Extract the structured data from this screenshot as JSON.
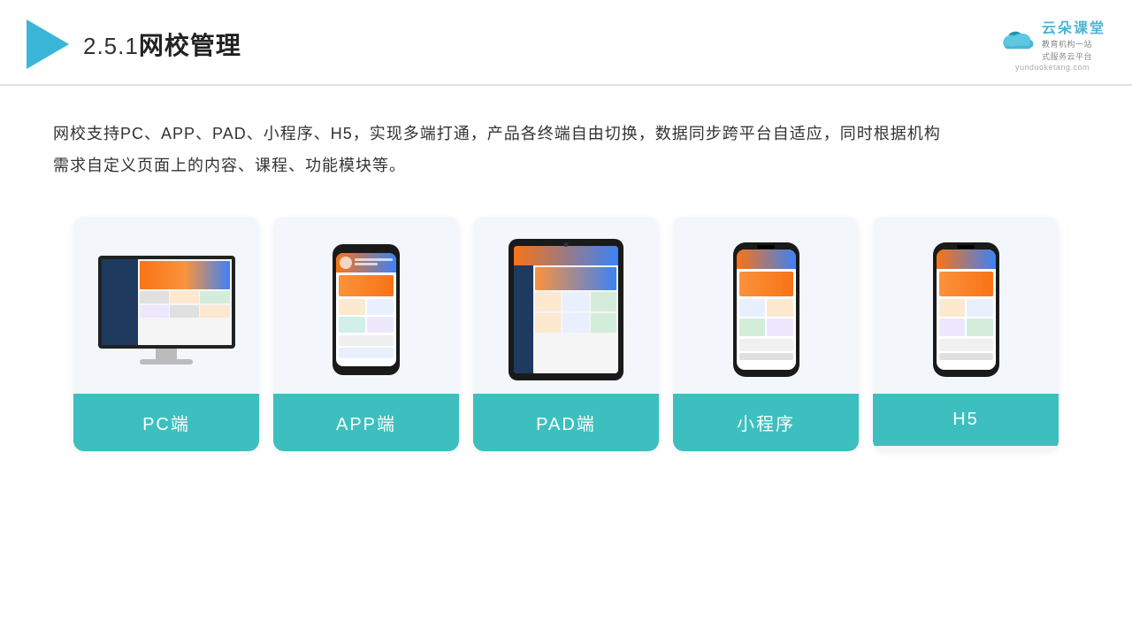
{
  "header": {
    "title": "网校管理",
    "title_number": "2.5.1",
    "brand_name": "云朵课堂",
    "brand_sub1": "教育机构一站",
    "brand_sub2": "式服务云平台",
    "brand_url": "yunduoketang.com"
  },
  "description": {
    "text1": "网校支持PC、APP、PAD、小程序、H5，实现多端打通，产品各终端自由切换，数据同步跨平台自适应，同时根据机构",
    "text2": "需求自定义页面上的内容、课程、功能模块等。"
  },
  "cards": [
    {
      "id": "pc",
      "label": "PC端"
    },
    {
      "id": "app",
      "label": "APP端"
    },
    {
      "id": "pad",
      "label": "PAD端"
    },
    {
      "id": "miniprogram",
      "label": "小程序"
    },
    {
      "id": "h5",
      "label": "H5"
    }
  ]
}
